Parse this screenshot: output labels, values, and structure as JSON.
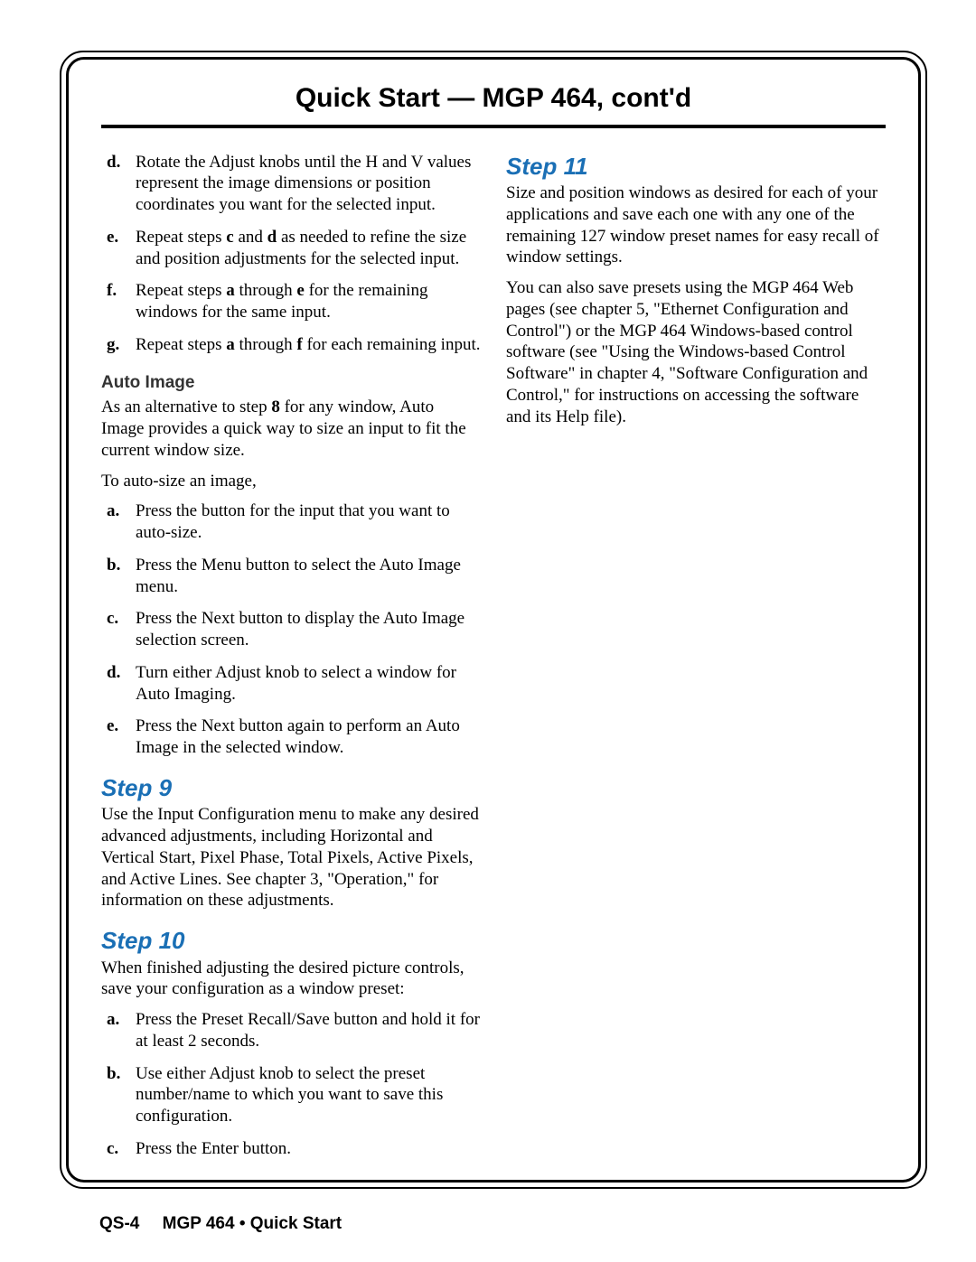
{
  "header": {
    "title": "Quick Start — MGP 464, cont'd"
  },
  "footer": {
    "page": "QS-4",
    "title": "MGP 464 • Quick Start"
  },
  "left": {
    "list1": {
      "d": "Rotate the Adjust knobs until the H and V values represent the image dimensions or position coordinates you want for the selected input.",
      "e_pre": "Repeat steps ",
      "e_b1": "c",
      "e_mid": " and ",
      "e_b2": "d",
      "e_post": " as needed to refine the size and position adjustments for the selected input.",
      "f_pre": "Repeat steps ",
      "f_b1": "a",
      "f_mid": " through ",
      "f_b2": "e",
      "f_post": " for the remaining windows for the same input.",
      "g_pre": "Repeat steps ",
      "g_b1": "a",
      "g_mid": " through ",
      "g_b2": "f",
      "g_post": " for each remaining input."
    },
    "auto_image": {
      "heading": "Auto Image",
      "p1_pre": "As an alternative to step ",
      "p1_b": "8",
      "p1_post": " for any window, Auto Image provides a quick way to size an input to fit the current window size.",
      "p2": "To auto-size an image,",
      "a": "Press the button for the input that you want to auto-size.",
      "b": "Press the Menu button to select the Auto Image menu.",
      "c": "Press the Next button to display the Auto Image selection screen.",
      "d": "Turn either Adjust knob to select a window for Auto Imaging.",
      "e": "Press the Next button again to perform an Auto Image in the selected window."
    },
    "step9": {
      "heading": "Step 9",
      "p": "Use the Input Configuration menu to make any desired advanced adjustments, including Horizontal and Vertical Start, Pixel Phase, Total Pixels, Active Pixels, and Active Lines.  See chapter 3, \"Operation,\" for information on these adjustments."
    },
    "step10": {
      "heading": "Step 10",
      "p": "When finished adjusting the desired picture controls, save your configuration as a window preset:",
      "a": "Press the Preset Recall/Save button and hold it for at least 2 seconds.",
      "b": "Use either Adjust knob to select the preset number/name to which you want to save this configuration.",
      "c": "Press the Enter button."
    }
  },
  "right": {
    "step11": {
      "heading": "Step 11",
      "p1": "Size and position windows as desired for each of your applications and save each one with any one of the remaining 127 window preset names for easy recall of window settings.",
      "p2": "You can also save presets using the MGP 464 Web pages (see chapter 5, \"Ethernet Configuration and Control\") or the MGP 464 Windows-based control software (see \"Using the Windows-based Control Software\" in chapter 4, \"Software Configuration and Control,\" for instructions on accessing the software and its Help file)."
    }
  },
  "markers": {
    "a": "a.",
    "b": "b.",
    "c": "c.",
    "d": "d.",
    "e": "e.",
    "f": "f.",
    "g": "g."
  }
}
